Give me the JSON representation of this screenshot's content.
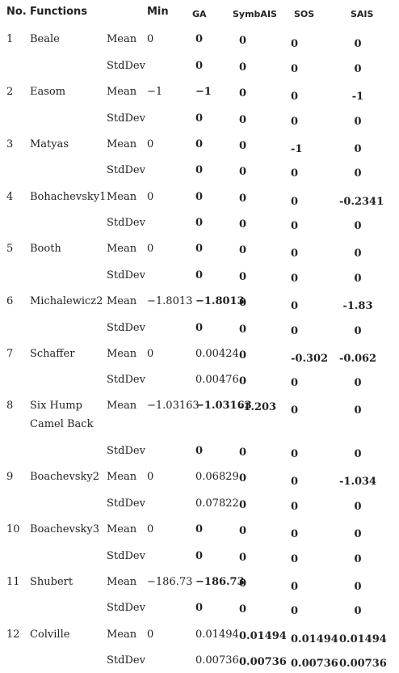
{
  "headers": {
    "no": "No.",
    "functions": "Functions",
    "stat": "",
    "min": "Min",
    "ga": "GA",
    "symbais": "SymbAIS",
    "sos": "SOS",
    "sais": "SAIS"
  },
  "rows": [
    {
      "no": "1",
      "fn": "Beale",
      "fn2": "",
      "mean": {
        "label": "Mean",
        "min": "0",
        "ga": "0",
        "sym": "0",
        "sos": "0",
        "sais": "0"
      },
      "std": {
        "label": "StdDev",
        "ga": "0",
        "sym": "0",
        "sos": "0",
        "sais": "0"
      }
    },
    {
      "no": "2",
      "fn": "Easom",
      "fn2": "",
      "mean": {
        "label": "Mean",
        "min": "−1",
        "ga": "−1",
        "sym": "0",
        "sos": "0",
        "sais": "-1"
      },
      "std": {
        "label": "StdDev",
        "ga": "0",
        "sym": "0",
        "sos": "0",
        "sais": "0"
      }
    },
    {
      "no": "3",
      "fn": "Matyas",
      "fn2": "",
      "mean": {
        "label": "Mean",
        "min": "0",
        "ga": "0",
        "sym": "0",
        "sos": "-1",
        "sais": "0"
      },
      "std": {
        "label": "StdDev",
        "ga": "0",
        "sym": "0",
        "sos": "0",
        "sais": "0"
      }
    },
    {
      "no": "4",
      "fn": "Bohachevsky1",
      "fn2": "",
      "mean": {
        "label": "Mean",
        "min": "0",
        "ga": "0",
        "sym": "0",
        "sos": "0",
        "sais": "-0.2341"
      },
      "std": {
        "label": "StdDev",
        "ga": "0",
        "sym": "0",
        "sos": "0",
        "sais": "0"
      }
    },
    {
      "no": "5",
      "fn": "Booth",
      "fn2": "",
      "mean": {
        "label": "Mean",
        "min": "0",
        "ga": "0",
        "sym": "0",
        "sos": "0",
        "sais": "0"
      },
      "std": {
        "label": "StdDev",
        "ga": "0",
        "sym": "0",
        "sos": "0",
        "sais": "0"
      }
    },
    {
      "no": "6",
      "fn": "Michalewicz2",
      "fn2": "",
      "mean": {
        "label": "Mean",
        "min": "−1.8013",
        "ga": "−1.8013",
        "sym": "0",
        "sos": "0",
        "sais": "-1.83"
      },
      "std": {
        "label": "StdDev",
        "ga": "0",
        "sym": "0",
        "sos": "0",
        "sais": "0"
      }
    },
    {
      "no": "7",
      "fn": "Schaffer",
      "fn2": "",
      "mean": {
        "label": "Mean",
        "min": "0",
        "ga": "0.00424",
        "sym": "0",
        "sos": "-0.302",
        "sais": "-0.062"
      },
      "std": {
        "label": "StdDev",
        "ga": "0.00476",
        "sym": "0",
        "sos": "0",
        "sais": "0"
      }
    },
    {
      "no": "8",
      "fn": "Six Hump",
      "fn2": "Camel Back",
      "mean": {
        "label": "Mean",
        "min": "−1.03163",
        "ga": "−1.03163",
        "sym": "-1.203",
        "sos": "0",
        "sais": "0"
      },
      "std": {
        "label": "StdDev",
        "ga": "0",
        "sym": "0",
        "sos": "0",
        "sais": "0"
      }
    },
    {
      "no": "9",
      "fn": "Boachevsky2",
      "fn2": "",
      "mean": {
        "label": "Mean",
        "min": "0",
        "ga": "0.06829",
        "sym": "0",
        "sos": "0",
        "sais": "-1.034"
      },
      "std": {
        "label": "StdDev",
        "ga": "0.07822",
        "sym": "0",
        "sos": "0",
        "sais": "0"
      }
    },
    {
      "no": "10",
      "fn": "Boachevsky3",
      "fn2": "",
      "mean": {
        "label": "Mean",
        "min": "0",
        "ga": "0",
        "sym": "0",
        "sos": "0",
        "sais": "0"
      },
      "std": {
        "label": "StdDev",
        "ga": "0",
        "sym": "0",
        "sos": "0",
        "sais": "0"
      }
    },
    {
      "no": "11",
      "fn": "Shubert",
      "fn2": "",
      "mean": {
        "label": "Mean",
        "min": "−186.73",
        "ga": "−186.73",
        "sym": "0",
        "sos": "0",
        "sais": "0"
      },
      "std": {
        "label": "StdDev",
        "ga": "0",
        "sym": "0",
        "sos": "0",
        "sais": "0"
      }
    },
    {
      "no": "12",
      "fn": "Colville",
      "fn2": "",
      "mean": {
        "label": "Mean",
        "min": "0",
        "ga": "0.01494",
        "sym": "0.01494",
        "sos": "0.01494",
        "sais": "0.01494"
      },
      "std": {
        "label": "StdDev",
        "ga": "0.00736",
        "sym": "0.00736",
        "sos": "0.00736",
        "sais": "0.00736"
      }
    }
  ]
}
